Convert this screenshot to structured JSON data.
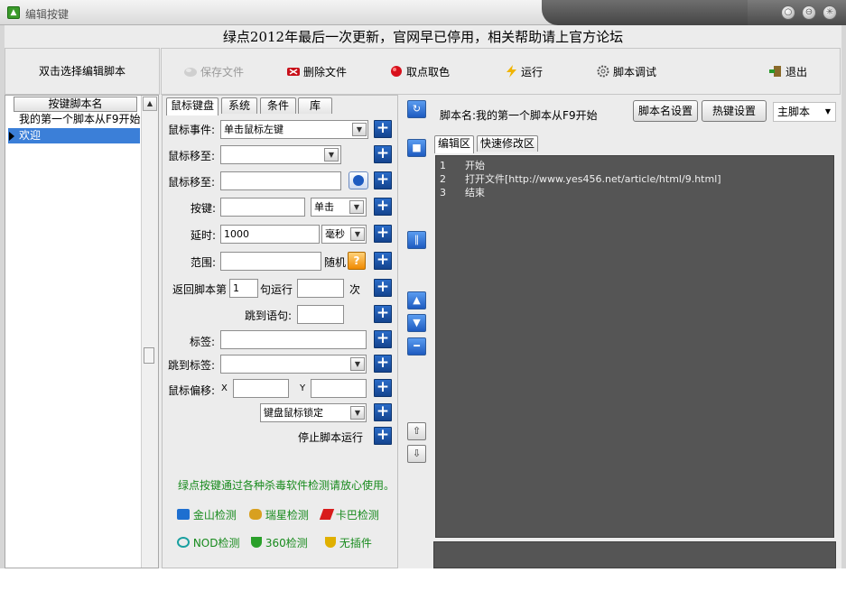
{
  "window": {
    "title": "编辑按键",
    "minimize_icon": "○",
    "restore_icon": "⊖",
    "close_icon": "✳"
  },
  "notice": "绿点2012年最后一次更新，官网早已停用，相关帮助请上官方论坛",
  "left_panel": {
    "label": "双击选择编辑脚本"
  },
  "toolbar": {
    "save": "保存文件",
    "delete": "删除文件",
    "pick_color": "取点取色",
    "run": "运行",
    "debug": "脚本调试",
    "exit": "退出"
  },
  "script_list": {
    "header": "按键脚本名",
    "items": [
      "我的第一个脚本从F9开始",
      "欢迎"
    ],
    "selected_index": 1
  },
  "form": {
    "tabs": [
      "鼠标键盘",
      "系统",
      "条件",
      "库"
    ],
    "mouse_event_label": "鼠标事件:",
    "mouse_event_value": "单击鼠标左键",
    "mouse_move1_label": "鼠标移至:",
    "mouse_move2_label": "鼠标移至:",
    "key_label": "按键:",
    "key_action": "单击",
    "delay_label": "延时:",
    "delay_value": "1000",
    "delay_unit": "毫秒",
    "range_label": "范围:",
    "random_label": "随机",
    "return_label": "返回脚本第",
    "return_value": "1",
    "return_suffix": "句运行",
    "times_label": "次",
    "jump_stmt_label": "跳到语句:",
    "tag_label": "标签:",
    "jump_tag_label": "跳到标签:",
    "offset_label": "鼠标偏移:",
    "x_label": "X",
    "y_label": "Y",
    "lock_value": "键盘鼠标锁定",
    "stop_label": "停止脚本运行",
    "safety_note": "绿点按键通过各种杀毒软件检测请放心使用。",
    "checks": [
      "金山检测",
      "瑞星检测",
      "卡巴检测",
      "NOD检测",
      "360检测",
      "无插件"
    ]
  },
  "editor": {
    "script_name_label": "脚本名:我的第一个脚本从F9开始",
    "name_settings_btn": "脚本名设置",
    "hotkey_btn": "热键设置",
    "main_script": "主脚本",
    "tabs": [
      "编辑区",
      "快速修改区"
    ],
    "lines": [
      {
        "n": "1",
        "t": "开始"
      },
      {
        "n": "2",
        "t": "打开文件[http://www.yes456.net/article/html/9.html]"
      },
      {
        "n": "3",
        "t": "结束"
      }
    ]
  },
  "colors": {
    "accent": "#1a55b0",
    "selection": "#3b7fd8",
    "editor_bg": "#555555",
    "check_text": "#178a1c"
  }
}
